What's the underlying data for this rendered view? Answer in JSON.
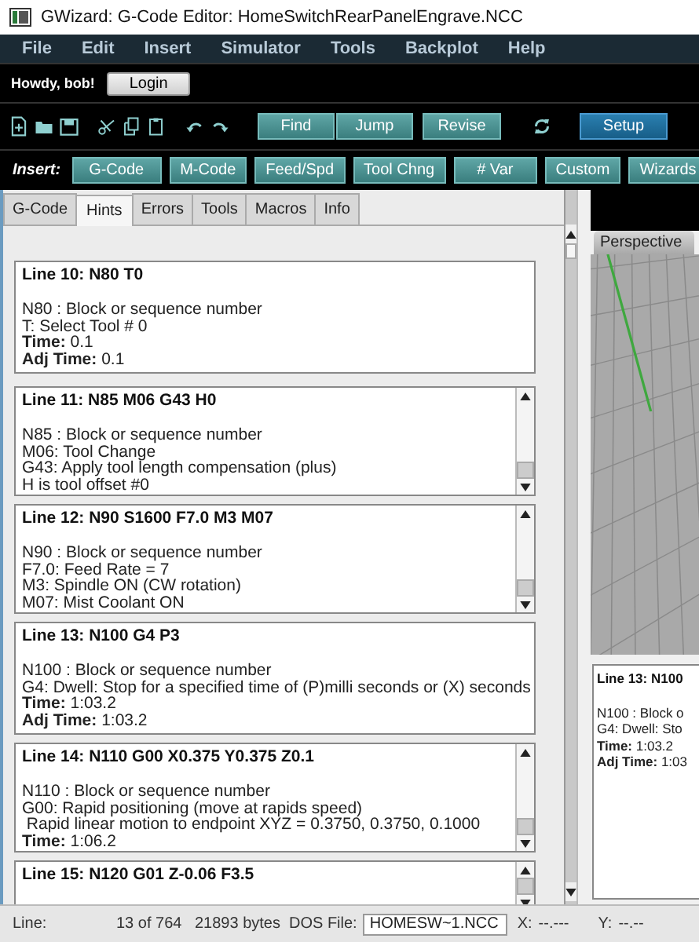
{
  "window": {
    "title": "GWizard: G-Code Editor: HomeSwitchRearPanelEngrave.NCC"
  },
  "menu": [
    "File",
    "Edit",
    "Insert",
    "Simulator",
    "Tools",
    "Backplot",
    "Help"
  ],
  "user": {
    "greeting": "Howdy, bob!",
    "login_button": "Login"
  },
  "toolbar": {
    "find_button": "Find",
    "jump_button": "Jump",
    "revise_button": "Revise",
    "setup_button": "Setup"
  },
  "insert_bar": {
    "label": "Insert:",
    "buttons": [
      "G-Code",
      "M-Code",
      "Feed/Spd",
      "Tool Chng",
      "# Var",
      "Custom",
      "Wizards"
    ]
  },
  "tabs": [
    {
      "label": "G-Code",
      "selected": false
    },
    {
      "label": "Hints",
      "selected": true
    },
    {
      "label": "Errors",
      "selected": false
    },
    {
      "label": "Tools",
      "selected": false
    },
    {
      "label": "Macros",
      "selected": false
    },
    {
      "label": "Info",
      "selected": false
    }
  ],
  "hints": [
    {
      "title": "Line 10: N80 T0",
      "scrollable": false,
      "lines": [
        "N80 : Block or sequence number",
        "T: Select Tool # 0",
        "**Time:** 0.1",
        "**Adj Time:** 0.1"
      ]
    },
    {
      "title": "Line 11: N85 M06 G43 H0",
      "scrollable": true,
      "lines": [
        "N85 : Block or sequence number",
        "M06: Tool Change",
        "G43: Apply tool length compensation (plus)",
        "H is tool offset #0"
      ]
    },
    {
      "title": "Line 12: N90 S1600 F7.0 M3 M07",
      "scrollable": true,
      "lines": [
        "N90 : Block or sequence number",
        "F7.0: Feed Rate = 7",
        "M3: Spindle ON (CW rotation)",
        "M07: Mist Coolant ON"
      ]
    },
    {
      "title": "Line 13: N100 G4 P3",
      "scrollable": false,
      "lines": [
        "N100 : Block or sequence number",
        "G4: Dwell: Stop for a specified time of (P)milli seconds or (X) seconds",
        "**Time:** 1:03.2",
        "**Adj Time:** 1:03.2"
      ]
    },
    {
      "title": "Line 14: N110 G00 X0.375 Y0.375 Z0.1",
      "scrollable": true,
      "lines": [
        "N110 : Block or sequence number",
        "G00: Rapid positioning (move at rapids speed)",
        " Rapid linear motion to endpoint XYZ = 0.3750, 0.3750, 0.1000",
        "**Time:** 1:06.2"
      ]
    },
    {
      "title": "Line 15: N120 G01 Z-0.06 F3.5",
      "scrollable": true
    }
  ],
  "viewport": {
    "tab": "Perspective"
  },
  "side_hint": {
    "title": "Line 13: N100",
    "lines": [
      "N100 : Block o",
      "G4: Dwell: Sto",
      "**Time:** 1:03.2",
      "**Adj Time:** 1:03"
    ]
  },
  "status_bar": {
    "line_label": "Line:",
    "position": "13 of 764",
    "size": "21893 bytes",
    "dos_file_label": "DOS File:",
    "dos_file": "HOMESW~1.NCC",
    "x_label": "X:",
    "x_value": "--.---",
    "y_label": "Y:",
    "y_value": "--.--"
  }
}
